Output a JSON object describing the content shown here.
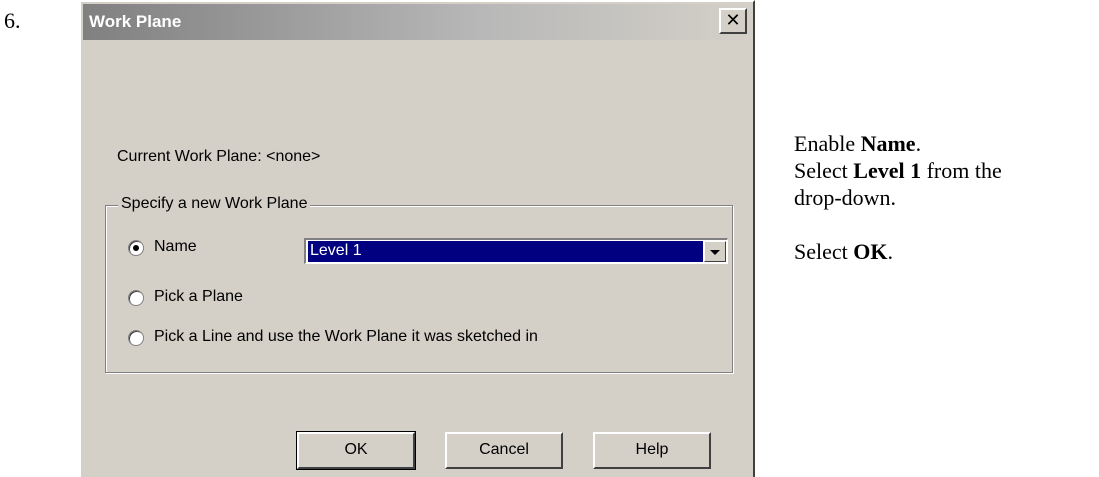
{
  "step": {
    "number": "6."
  },
  "dialog": {
    "title": "Work Plane",
    "close_glyph": "✕",
    "current_label": "Current Work Plane:  <none>",
    "group_label": "Specify a new Work Plane",
    "options": [
      {
        "label": "Name",
        "selected": true
      },
      {
        "label": "Pick a Plane",
        "selected": false
      },
      {
        "label": "Pick a Line and use the Work Plane it was sketched in",
        "selected": false
      }
    ],
    "name_select": {
      "value": "Level 1"
    },
    "buttons": {
      "ok": "OK",
      "cancel": "Cancel",
      "help": "Help"
    },
    "colors": {
      "face": "#d4d0c8",
      "selection": "#000080",
      "title_gradient_start": "#808080"
    }
  },
  "instructions": {
    "line1_prefix": "Enable ",
    "line1_bold": "Name",
    "line1_suffix": ".",
    "line2_prefix": "Select ",
    "line2_bold": "Level 1",
    "line2_suffix": " from the",
    "line3": "drop-down.",
    "line4_prefix": "Select ",
    "line4_bold": "OK",
    "line4_suffix": "."
  }
}
